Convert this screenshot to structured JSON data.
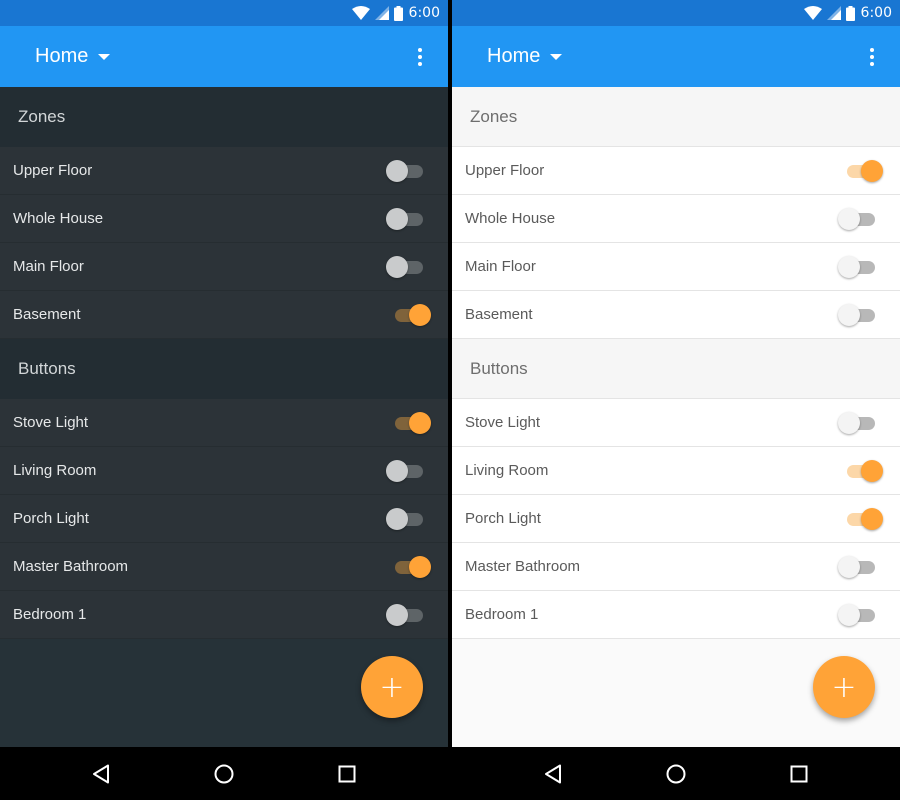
{
  "theme_colors": {
    "primary": "#2196f3",
    "status_bar": "#1976d2",
    "accent": "#ffa337",
    "dark_background": "#263238",
    "light_background": "#fafafa"
  },
  "screens": [
    {
      "theme": "dark",
      "status": {
        "time": "6:00",
        "icons": [
          "wifi-icon",
          "signal-icon",
          "battery-icon"
        ]
      },
      "appbar": {
        "title": "Home",
        "dropdown_icon": "arrow-drop-down-icon",
        "menu_icon": "more-vert-icon"
      },
      "sections": [
        {
          "header": "Zones",
          "items": [
            {
              "label": "Upper Floor",
              "on": false
            },
            {
              "label": "Whole House",
              "on": false
            },
            {
              "label": "Main Floor",
              "on": false
            },
            {
              "label": "Basement",
              "on": true
            }
          ]
        },
        {
          "header": "Buttons",
          "items": [
            {
              "label": "Stove Light",
              "on": true
            },
            {
              "label": "Living Room",
              "on": false
            },
            {
              "label": "Porch Light",
              "on": false
            },
            {
              "label": "Master Bathroom",
              "on": true
            },
            {
              "label": "Bedroom 1",
              "on": false
            }
          ]
        }
      ],
      "fab": {
        "label": "+"
      },
      "nav": [
        "back-icon",
        "home-icon",
        "recents-icon"
      ]
    },
    {
      "theme": "light",
      "status": {
        "time": "6:00",
        "icons": [
          "wifi-icon",
          "signal-icon",
          "battery-icon"
        ]
      },
      "appbar": {
        "title": "Home",
        "dropdown_icon": "arrow-drop-down-icon",
        "menu_icon": "more-vert-icon"
      },
      "sections": [
        {
          "header": "Zones",
          "items": [
            {
              "label": "Upper Floor",
              "on": true
            },
            {
              "label": "Whole House",
              "on": false
            },
            {
              "label": "Main Floor",
              "on": false
            },
            {
              "label": "Basement",
              "on": false
            }
          ]
        },
        {
          "header": "Buttons",
          "items": [
            {
              "label": "Stove Light",
              "on": false
            },
            {
              "label": "Living Room",
              "on": true
            },
            {
              "label": "Porch Light",
              "on": true
            },
            {
              "label": "Master Bathroom",
              "on": false
            },
            {
              "label": "Bedroom 1",
              "on": false
            }
          ]
        }
      ],
      "fab": {
        "label": "+"
      },
      "nav": [
        "back-icon",
        "home-icon",
        "recents-icon"
      ]
    }
  ]
}
